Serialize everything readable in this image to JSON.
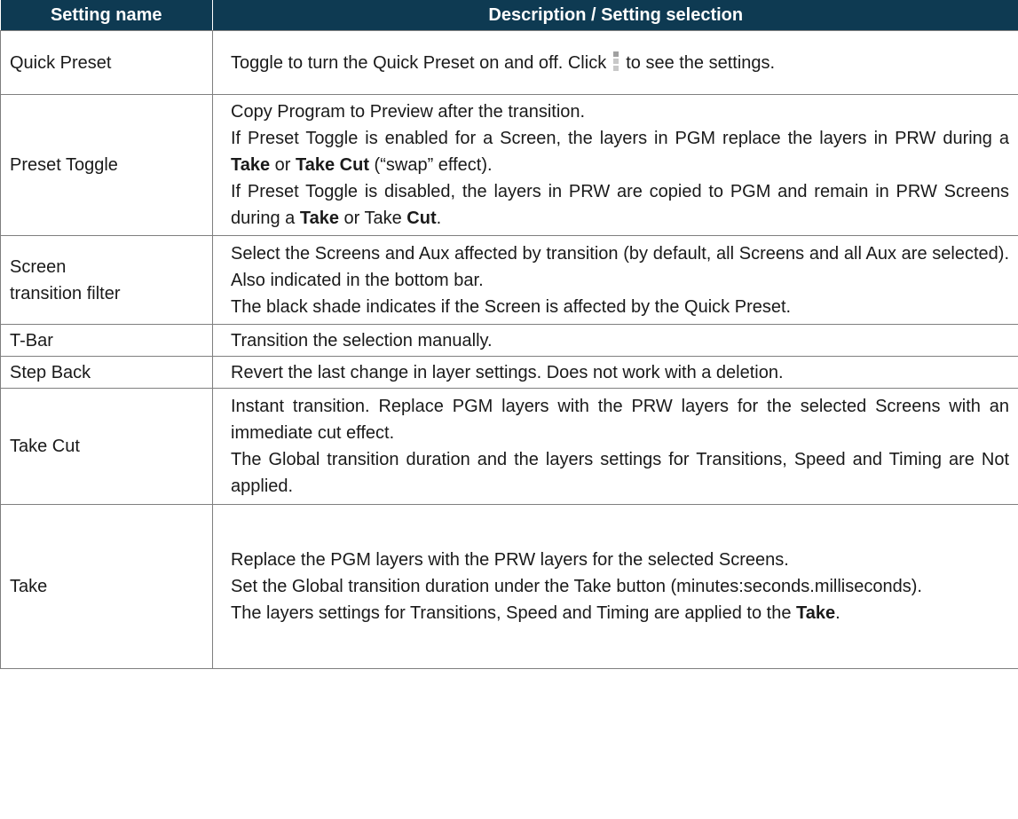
{
  "header": {
    "col1": "Setting name",
    "col2": "Description / Setting selection"
  },
  "rows": [
    {
      "name": "Quick Preset",
      "desc_before_icon": "Toggle to turn the Quick Preset on and off. Click",
      "icon": "kebab-menu-icon",
      "desc_after_icon": "to see the settings."
    },
    {
      "name": "Preset Toggle",
      "p1": "Copy Program to Preview after the transition.",
      "p2_a": "If Preset Toggle is enabled for a Screen, the layers in PGM replace the layers in PRW during a ",
      "p2_b": "Take",
      "p2_c": " or ",
      "p2_d": "Take Cut",
      "p2_e": " (“swap” effect).",
      "p3_a": "If Preset Toggle is disabled, the layers in PRW are copied to PGM and remain in PRW Screens during a ",
      "p3_b": "Take",
      "p3_c": " or Take ",
      "p3_d": "Cut",
      "p3_e": "."
    },
    {
      "name_line1": "Screen",
      "name_line2": "transition filter",
      "p1": "Select the Screens and Aux affected by transition (by default, all Screens and all Aux are selected). Also indicated in the bottom bar.",
      "p2": "The black shade indicates if the Screen is affected by the Quick Preset."
    },
    {
      "name": "T-Bar",
      "desc": "Transition the selection manually."
    },
    {
      "name": "Step Back",
      "desc": "Revert the last change in layer settings. Does not work with a deletion."
    },
    {
      "name": "Take Cut",
      "p1": "Instant transition. Replace PGM layers with the PRW layers for the selected Screens with an immediate cut effect.",
      "p2": "The Global transition duration and the layers settings for Transitions, Speed and Timing are Not applied."
    },
    {
      "name": "Take",
      "p1": "Replace the PGM layers with the PRW layers for the selected Screens.",
      "p2": "Set the Global transition duration under the Take button (minutes:seconds.milliseconds).",
      "p3_a": "The layers settings for Transitions, Speed and Timing are applied to the ",
      "p3_b": "Take",
      "p3_c": "."
    }
  ],
  "colors": {
    "header_bg": "#0e3a52",
    "header_text": "#ffffff",
    "border": "#7f7f7f"
  }
}
